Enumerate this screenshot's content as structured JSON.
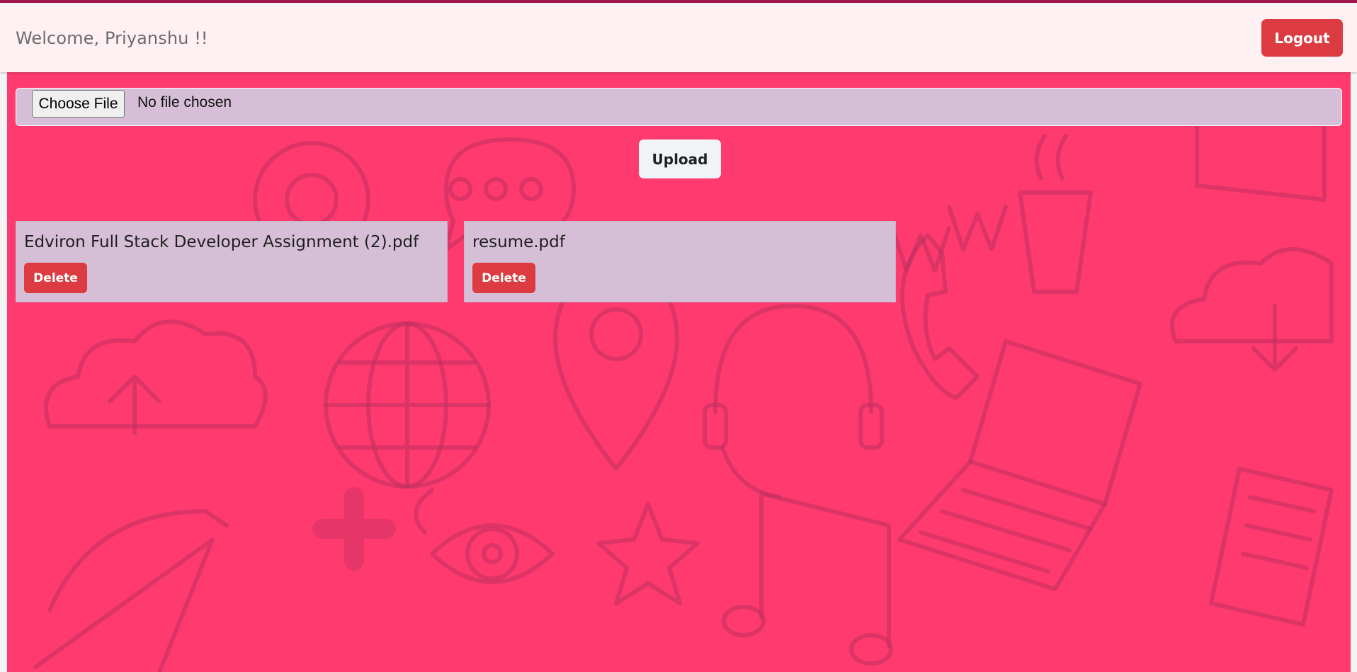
{
  "header": {
    "welcome_text": "Welcome, Priyanshu !!",
    "logout_label": "Logout"
  },
  "upload": {
    "choose_file_label": "Choose File",
    "no_file_text": "No file chosen",
    "upload_label": "Upload"
  },
  "files": [
    {
      "name": "Edviron Full Stack Developer Assignment (2).pdf",
      "delete_label": "Delete"
    },
    {
      "name": "resume.pdf",
      "delete_label": "Delete"
    }
  ],
  "colors": {
    "accent_stripe": "#a3154f",
    "navbar_bg": "#fff0f3",
    "danger": "#dc3c41",
    "page_bg": "#ff3a6e",
    "card_bg": "#d6bfd6",
    "doodle_stroke": "#c03060"
  },
  "icons": [
    "cloud-upload-icon",
    "globe-icon",
    "map-pin-icon",
    "headset-icon",
    "laptop-icon",
    "coffee-cup-icon",
    "cloud-download-icon",
    "eye-icon",
    "music-note-icon",
    "speech-bubble-icon",
    "at-sign-icon",
    "phone-icon",
    "notebook-icon",
    "paper-plane-icon",
    "star-icon",
    "plus-icon"
  ]
}
